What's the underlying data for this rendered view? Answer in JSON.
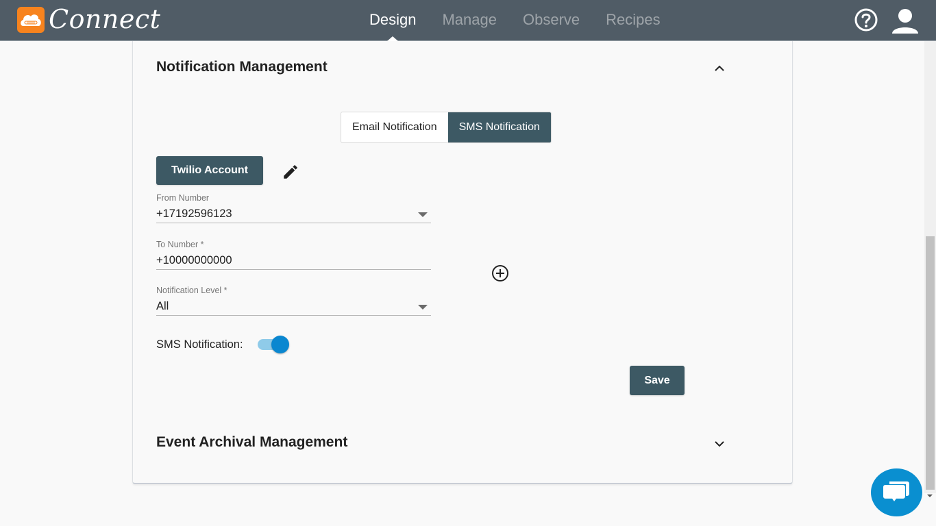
{
  "app": {
    "logo_text": "Connect",
    "brand_color": "#f7831e"
  },
  "nav": {
    "items": [
      {
        "label": "Design",
        "active": true
      },
      {
        "label": "Manage",
        "active": false
      },
      {
        "label": "Observe",
        "active": false
      },
      {
        "label": "Recipes",
        "active": false
      }
    ],
    "help_icon": "question-circle-icon",
    "user_icon": "user-account-icon"
  },
  "notification_section": {
    "title": "Notification Management",
    "expanded": true,
    "tabs": [
      {
        "label": "Email Notification",
        "active": false
      },
      {
        "label": "SMS Notification",
        "active": true
      }
    ],
    "account_button": "Twilio Account",
    "from_number": {
      "label": "From Number",
      "value": "+17192596123"
    },
    "to_number": {
      "label": "To Number *",
      "value": "+10000000000"
    },
    "notification_level": {
      "label": "Notification Level *",
      "value": "All"
    },
    "sms_toggle": {
      "label": "SMS Notification:",
      "on": true
    },
    "save_label": "Save"
  },
  "event_archival_section": {
    "title": "Event Archival Management",
    "expanded": false
  },
  "colors": {
    "primary": "#3d5964",
    "toggle_on": "#0a87d0",
    "chat": "#0a8fd0"
  }
}
